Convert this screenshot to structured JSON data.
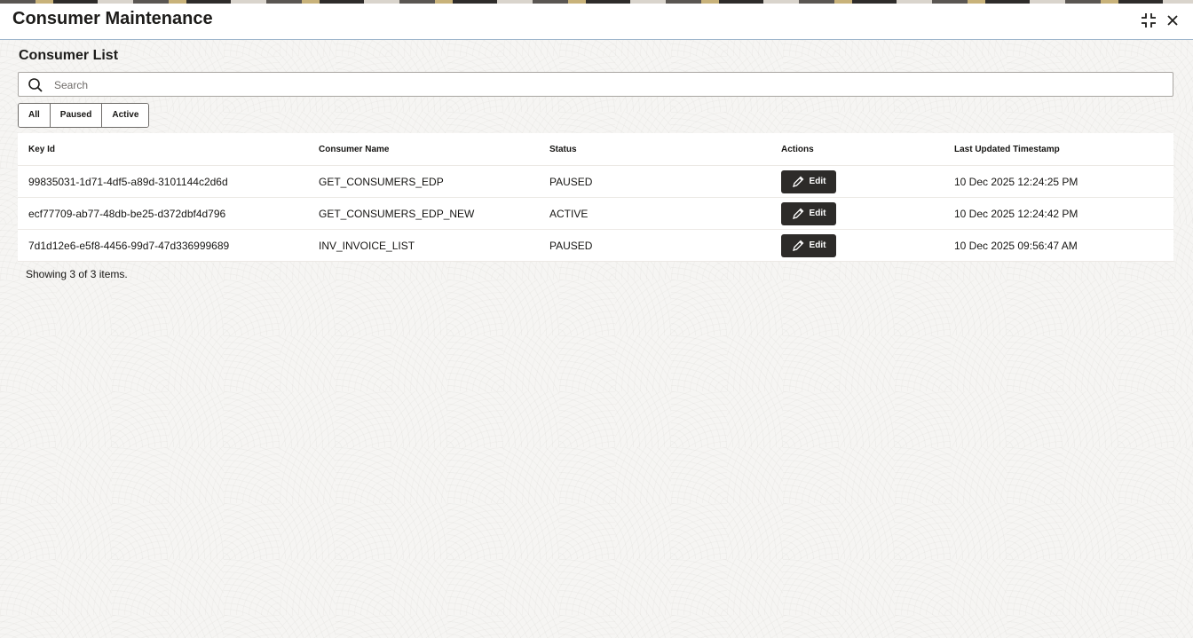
{
  "window": {
    "title": "Consumer Maintenance",
    "maximize_icon": "collapse-arrows-icon",
    "close_icon": "close-icon"
  },
  "section": {
    "title": "Consumer List"
  },
  "search": {
    "placeholder": "Search",
    "value": "",
    "icon": "search-icon"
  },
  "filters": [
    "All",
    "Paused",
    "Active"
  ],
  "table": {
    "columns": [
      "Key Id",
      "Consumer Name",
      "Status",
      "Actions",
      "Last Updated Timestamp"
    ],
    "rows": [
      {
        "key_id": "99835031-1d71-4df5-a89d-3101144c2d6d",
        "consumer_name": "GET_CONSUMERS_EDP",
        "status": "PAUSED",
        "action_label": "Edit",
        "timestamp": "10 Dec 2025 12:24:25 PM"
      },
      {
        "key_id": "ecf77709-ab77-48db-be25-d372dbf4d796",
        "consumer_name": "GET_CONSUMERS_EDP_NEW",
        "status": "ACTIVE",
        "action_label": "Edit",
        "timestamp": "10 Dec 2025 12:24:42 PM"
      },
      {
        "key_id": "7d1d12e6-e5f8-4456-99d7-47d336999689",
        "consumer_name": "INV_INVOICE_LIST",
        "status": "PAUSED",
        "action_label": "Edit",
        "timestamp": "10 Dec 2025 09:56:47 AM"
      }
    ]
  },
  "footer": {
    "showing": "Showing 3 of 3 items."
  }
}
